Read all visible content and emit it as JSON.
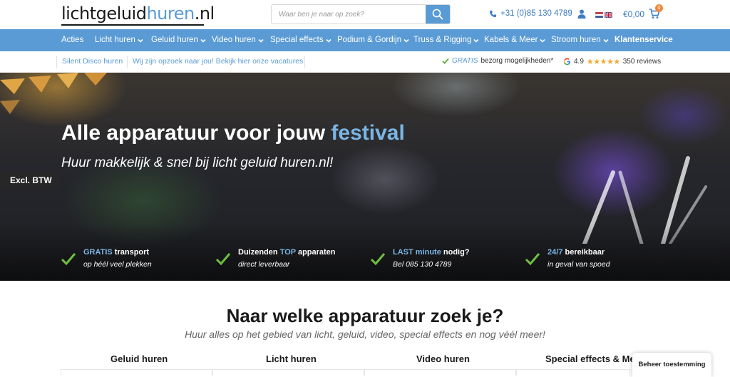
{
  "header": {
    "logo": {
      "part1": "lichtgeluid",
      "part2": "huren",
      "part3": ".nl"
    },
    "search": {
      "placeholder": "Waar ben je naar op zoek?",
      "icon": "search-icon"
    },
    "phone": "+31 (0)85 130 4789",
    "cart_total": "€0,00",
    "cart_count": "0",
    "colors": {
      "brand_blue": "#5a9bd5",
      "badge_orange": "#f0883e"
    }
  },
  "nav": {
    "items": [
      {
        "label": "Acties"
      },
      {
        "label": "Licht huren"
      },
      {
        "label": "Geluid huren"
      },
      {
        "label": "Video huren"
      },
      {
        "label": "Special effects"
      },
      {
        "label": "Podium & Gordijn"
      },
      {
        "label": "Truss & Rigging"
      },
      {
        "label": "Kabels & Meer"
      },
      {
        "label": "Stroom huren"
      },
      {
        "label": "Klantenservice"
      }
    ]
  },
  "subbar": {
    "link1": "Silent Disco huren",
    "link2": "Wij zijn opzoek naar jou! Bekijk hier onze vacatures",
    "gratis_word": "GRATIS",
    "gratis_rest": "bezorg mogelijkheden*",
    "rating_value": "4.9",
    "stars": "★★★★★",
    "reviews": "350 reviews"
  },
  "hero": {
    "title_main": "Alle apparatuur voor jouw",
    "title_accent": "festival",
    "subtitle": "Huur makkelijk & snel bij licht geluid huren.nl!",
    "excl": "Excl. BTW",
    "usps": [
      {
        "hl": "GRATIS",
        "rest": " transport",
        "line2": "op héél veel plekken"
      },
      {
        "pre": "Duizenden ",
        "hl": "TOP",
        "rest": " apparaten",
        "line2": "direct leverbaar"
      },
      {
        "hl": "LAST minute",
        "rest": " nodig?",
        "line2": "Bel 085 130 4789"
      },
      {
        "hl": "24/7",
        "rest": " bereikbaar",
        "line2": "in geval van spoed"
      }
    ]
  },
  "main": {
    "title": "Naar welke apparatuur zoek je?",
    "subtitle": "Huur alles op het gebied van licht, geluid, video, special effects en nog véél meer!",
    "categories": [
      "Geluid huren",
      "Licht huren",
      "Video huren",
      "Special effects & Mee"
    ]
  },
  "consent": "Beheer toestemming"
}
